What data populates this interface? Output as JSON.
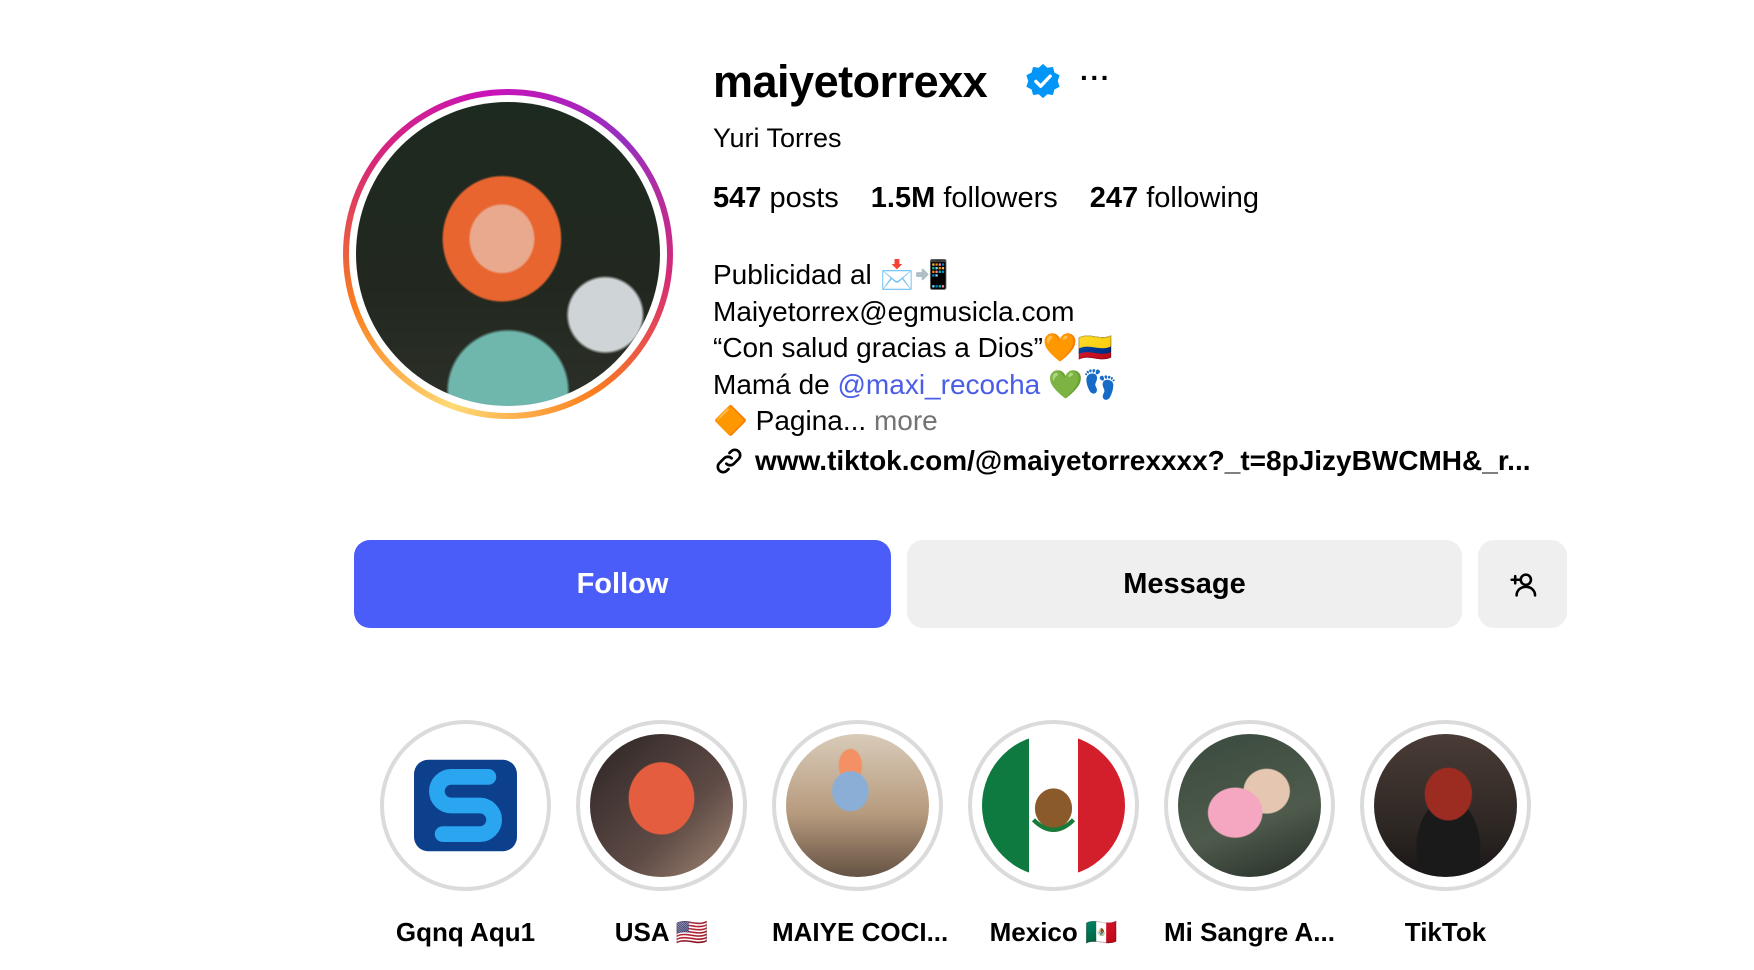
{
  "profile": {
    "username": "maiyetorrexx",
    "full_name": "Yuri Torres",
    "verified": true,
    "more_label": "···",
    "stats": {
      "posts_count": "547",
      "posts_label": "posts",
      "followers_count": "1.5M",
      "followers_label": "followers",
      "following_count": "247",
      "following_label": "following"
    },
    "bio": {
      "line1": "Publicidad al 📩📲",
      "line2": "Maiyetorrex@egmusicla.com",
      "line3": "“Con salud gracias a Dios”🧡🇨🇴",
      "line4_prefix": "Mamá de ",
      "line4_mention": "@maxi_recocha",
      "line4_suffix": " 💚👣",
      "line5": "🔶 Pagina...",
      "more_label": "more"
    },
    "link": "www.tiktok.com/@maiyetorrexxxx?_t=8pJizyBWCMH&_r..."
  },
  "actions": {
    "follow_label": "Follow",
    "message_label": "Message",
    "suggest_icon": "add-person-icon"
  },
  "highlights": [
    {
      "label": "Gqnq Aqu1"
    },
    {
      "label": "USA 🇺🇸"
    },
    {
      "label": "MAIYE COCI..."
    },
    {
      "label": "Mexico 🇲🇽"
    },
    {
      "label": "Mi Sangre A..."
    },
    {
      "label": "TikTok"
    }
  ],
  "colors": {
    "follow_button": "#4a5df9",
    "secondary_button": "#efefef",
    "mention": "#4a5de7",
    "verified": "#0095f6"
  }
}
